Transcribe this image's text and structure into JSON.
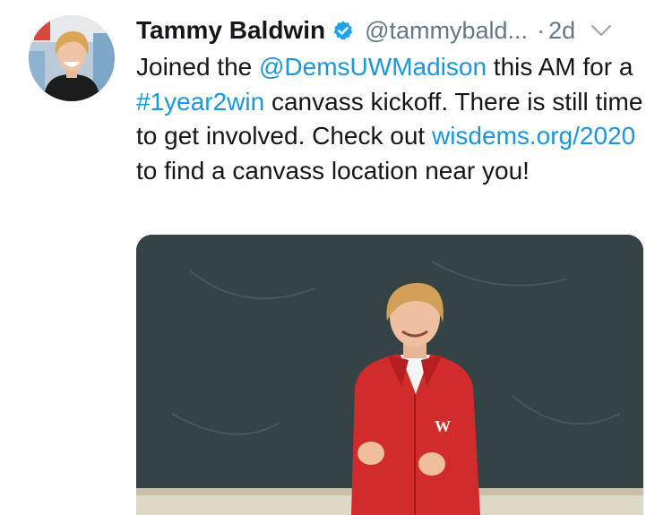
{
  "tweet": {
    "author": {
      "name": "Tammy Baldwin",
      "handle": "@tammybald...",
      "verified_icon": "verified-badge-icon",
      "avatar": "profile-photo"
    },
    "separator": "·",
    "timestamp": "2d",
    "menu_icon": "chevron-down-icon",
    "text": {
      "t1": "Joined the ",
      "mention": "@DemsUWMadison",
      "t2": " this AM for a ",
      "hashtag": "#1year2win",
      "t3": " canvass kickoff. There is still time to get involved. Check out ",
      "url": "wisdems.org/2020",
      "t4": " to find a canvass location near you!"
    },
    "media": {
      "type": "photo",
      "jersey_logo": "W"
    }
  },
  "colors": {
    "link": "#1b95e0",
    "muted": "#657786",
    "verified": "#1da1f2",
    "text": "#14171a"
  }
}
